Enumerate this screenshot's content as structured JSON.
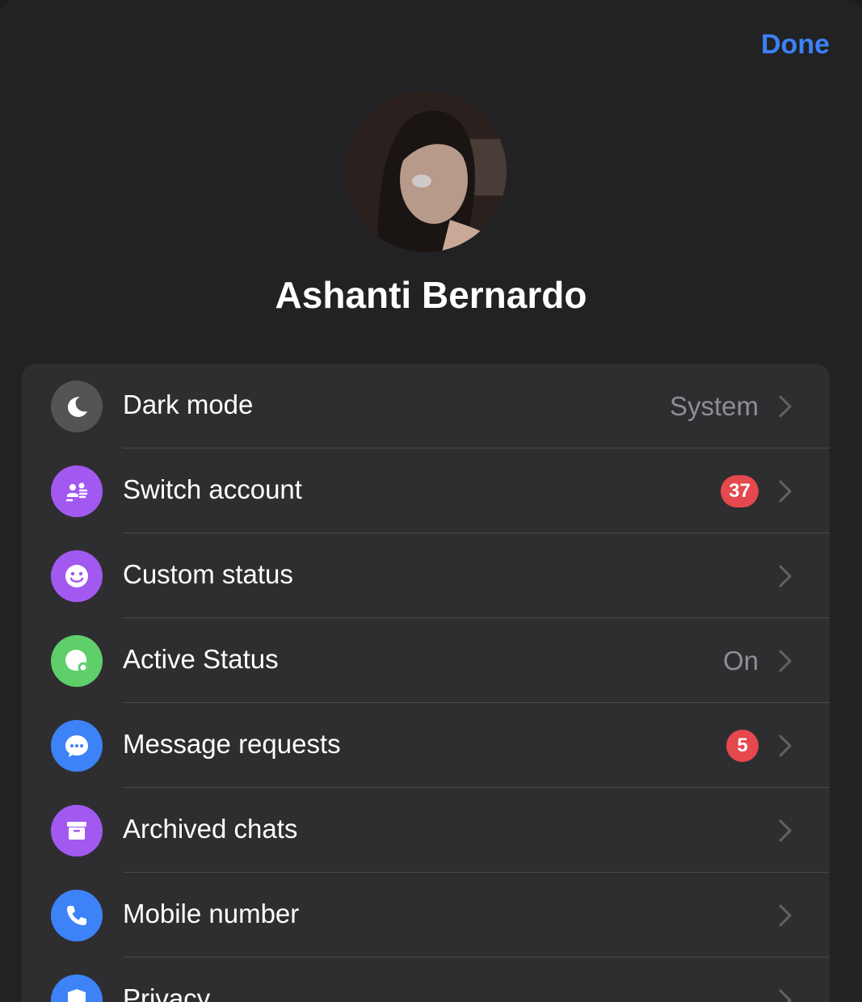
{
  "header": {
    "done_label": "Done"
  },
  "profile": {
    "name": "Ashanti Bernardo"
  },
  "settings": {
    "items": [
      {
        "label": "Dark mode",
        "value": "System",
        "icon": "moon-icon",
        "color": "#545456"
      },
      {
        "label": "Switch account",
        "badge": "37",
        "icon": "switch-account-icon",
        "color": "#a259f0"
      },
      {
        "label": "Custom status",
        "icon": "smiley-icon",
        "color": "#a259f0"
      },
      {
        "label": "Active Status",
        "value": "On",
        "icon": "active-status-icon",
        "color": "#5fcf6a"
      },
      {
        "label": "Message requests",
        "badge": "5",
        "icon": "chat-bubble-icon",
        "color": "#3d82f6"
      },
      {
        "label": "Archived chats",
        "icon": "archive-box-icon",
        "color": "#a259f0"
      },
      {
        "label": "Mobile number",
        "icon": "phone-icon",
        "color": "#3d82f6"
      },
      {
        "label": "Privacy",
        "icon": "shield-icon",
        "color": "#3d82f6"
      }
    ]
  }
}
